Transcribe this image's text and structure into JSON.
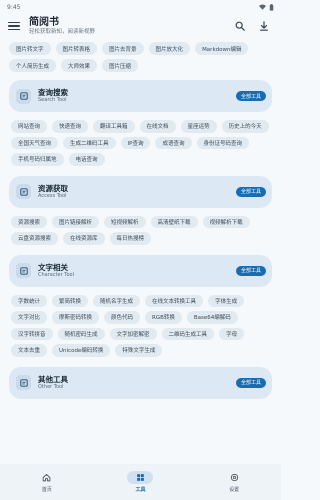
{
  "status": {
    "time": "9:45"
  },
  "app": {
    "title": "简阅书",
    "subtitle": "轻松获取新知，阅读新视野"
  },
  "top_chips": [
    "图片转文字",
    "图片转表格",
    "图片去背景",
    "图片放大化",
    "Markdown编辑",
    "个人简历生成",
    "大师效果",
    "图片压缩"
  ],
  "sections": [
    {
      "title": "查询搜索",
      "subtitle": "Search Tool",
      "badge": "全部工具",
      "chips": [
        "网站查询",
        "快递查询",
        "翻译工具箱",
        "在线文档",
        "星座运势",
        "历史上的今天",
        "全国天气查询",
        "生成二维码工具",
        "IP查询",
        "成语查询",
        "身份证号码查询",
        "手机号码归属地",
        "电话查询"
      ]
    },
    {
      "title": "资源获取",
      "subtitle": "Access Tool",
      "badge": "全部工具",
      "chips": [
        "资源搜索",
        "图片链接解析",
        "短视频解析",
        "高清壁纸下载",
        "视频解析下载",
        "云盘资源搜索",
        "在线资源库",
        "每日热搜榜"
      ]
    },
    {
      "title": "文字相关",
      "subtitle": "Character Tool",
      "badge": "全部工具",
      "chips": [
        "字数统计",
        "繁简转换",
        "随机名字生成",
        "在线文本转换工具",
        "字体生成",
        "文字对比",
        "摩斯密码转换",
        "颜色代码",
        "RGB转换",
        "Base64编解码",
        "汉字转拼音",
        "随机密码生成",
        "文字加密解密",
        "二维码生成工具",
        "字母",
        "文本去重",
        "Unicode编码转换",
        "特殊文字生成"
      ]
    },
    {
      "title": "其他工具",
      "subtitle": "Other Tool",
      "badge": "全部工具",
      "chips": []
    }
  ],
  "nav": [
    {
      "label": "首页",
      "active": false
    },
    {
      "label": "工具",
      "active": true
    },
    {
      "label": "设置",
      "active": false
    }
  ],
  "colors": {
    "accent": "#1a6cb0",
    "card": "#dce9f4",
    "chip": "#e2eaf1"
  }
}
